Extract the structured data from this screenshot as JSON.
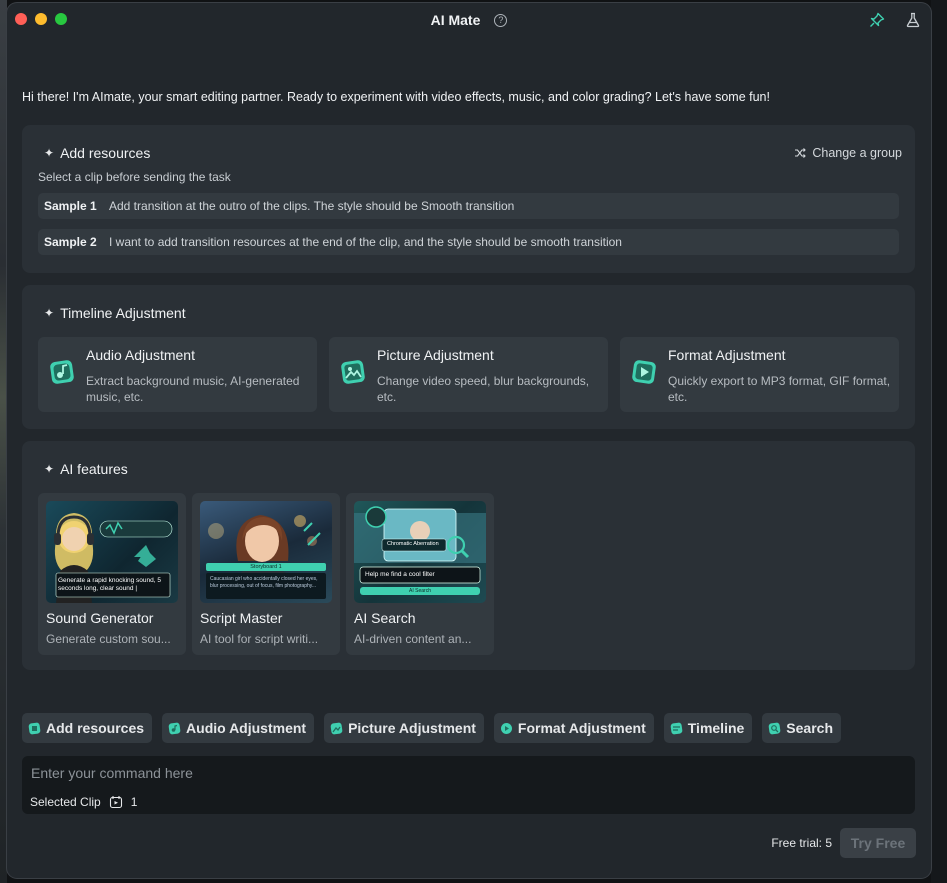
{
  "window": {
    "title": "AI Mate"
  },
  "greeting": "Hi there! I'm AImate, your smart editing partner. Ready to experiment with video effects, music, and color grading? Let's have some fun!",
  "add_resources": {
    "title": "Add resources",
    "subtitle": "Select a clip before sending the task",
    "change_group": "Change a group",
    "samples": [
      {
        "label": "Sample 1",
        "text": "Add transition at the outro of the clips. The style should be Smooth transition"
      },
      {
        "label": "Sample 2",
        "text": "I want to add transition resources at the end of the clip, and the style should be smooth transition"
      }
    ]
  },
  "timeline_adjustment": {
    "title": "Timeline Adjustment",
    "cards": [
      {
        "title": "Audio Adjustment",
        "desc": "Extract background music, AI-generated music, etc."
      },
      {
        "title": "Picture Adjustment",
        "desc": "Change video speed, blur backgrounds, etc."
      },
      {
        "title": "Format Adjustment",
        "desc": "Quickly export to MP3 format, GIF format, etc."
      }
    ]
  },
  "ai_features": {
    "title": "AI features",
    "items": [
      {
        "title": "Sound Generator",
        "desc": "Generate custom sou...",
        "thumb_text": "Generate a rapid knocking sound, 5 seconds long, clear sound |"
      },
      {
        "title": "Script Master",
        "desc": "AI tool for script writi...",
        "thumb_label": "Storyboard 1",
        "thumb_text": "Caucasian girl who accidentally closed her eyes, blur processing, out of focus, film photography..."
      },
      {
        "title": "AI Search",
        "desc": "AI-driven content an...",
        "thumb_chip": "Chromatic Aberration",
        "thumb_text": "Help me find a cool filter",
        "thumb_button": "AI Search"
      }
    ]
  },
  "chips": [
    "Add resources",
    "Audio Adjustment",
    "Picture Adjustment",
    "Format Adjustment",
    "Timeline",
    "Search"
  ],
  "command": {
    "placeholder": "Enter your command here",
    "selected_clip_label": "Selected Clip",
    "selected_clip_count": "1"
  },
  "footer": {
    "free_trial": "Free trial: 5",
    "try_button": "Try Free"
  },
  "colors": {
    "accent": "#3fd0b0",
    "panel": "#2a3036",
    "card": "#333a40"
  }
}
